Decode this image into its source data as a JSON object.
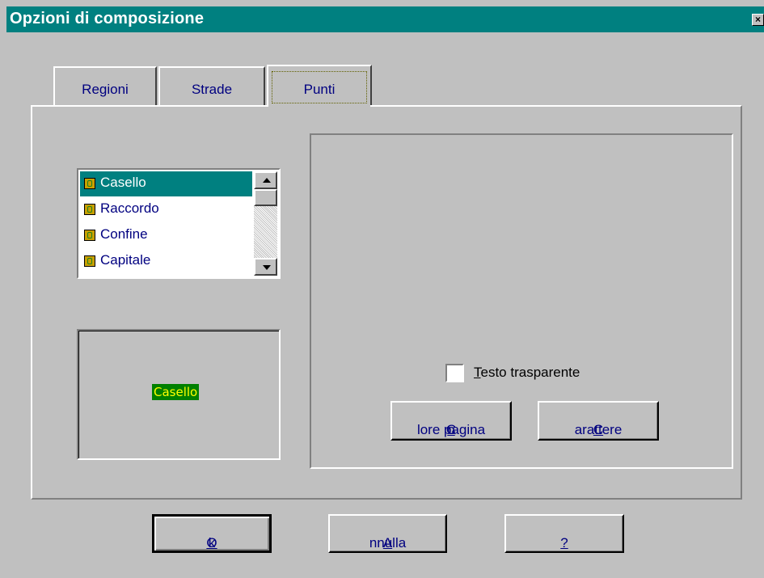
{
  "window": {
    "title": "Opzioni di composizione",
    "close_label": "×"
  },
  "tabs": [
    {
      "label": "Regioni",
      "active": false
    },
    {
      "label": "Strade",
      "active": false
    },
    {
      "label": "Punti",
      "active": true
    }
  ],
  "list": {
    "items": [
      {
        "label": "Casello",
        "selected": true
      },
      {
        "label": "Raccordo",
        "selected": false
      },
      {
        "label": "Confine",
        "selected": false
      },
      {
        "label": "Capitale",
        "selected": false
      }
    ]
  },
  "preview": {
    "text": "Casello",
    "background": "#008000",
    "foreground": "#ffff00"
  },
  "options": {
    "transparent_text": {
      "accel": "T",
      "rest": "esto trasparente",
      "checked": false
    },
    "page_color_button": {
      "accel": "o",
      "before": "C",
      "rest": "lore pagina"
    },
    "font_button": {
      "accel": "C",
      "rest": "arattere"
    }
  },
  "footer": {
    "ok": {
      "accel": "O",
      "rest": "k"
    },
    "cancel": {
      "accel": "A",
      "rest": "nnulla"
    },
    "help": {
      "accel": "?"
    }
  },
  "colors": {
    "title_bar": "#008080",
    "face": "#c0c0c0",
    "selection": "#008080",
    "text": "#000080"
  }
}
